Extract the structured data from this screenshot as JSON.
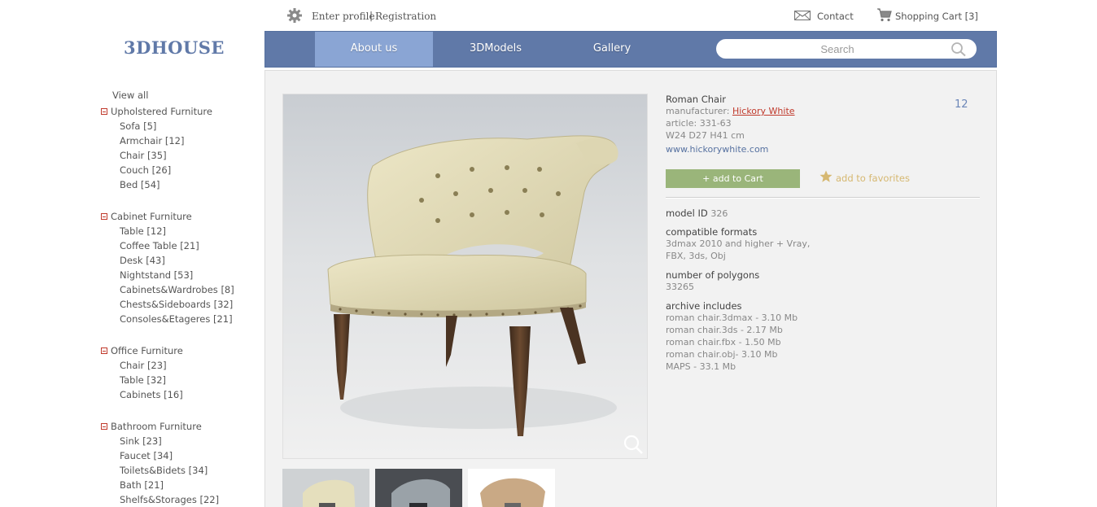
{
  "topbar": {
    "enter_profile": "Enter profile",
    "separator": "|",
    "registration": "Registration",
    "contact": "Contact",
    "cart": "Shopping Cart [3]"
  },
  "logo": "3DHOUSE",
  "nav": {
    "items": [
      {
        "label": "About us",
        "active": true
      },
      {
        "label": "3DModels",
        "active": false
      },
      {
        "label": "Gallery",
        "active": false
      }
    ],
    "search_placeholder": "Search"
  },
  "sidebar": {
    "view_all": "View all",
    "categories": [
      {
        "title": "Upholstered Furniture",
        "items": [
          "Sofa [5]",
          "Armchair [12]",
          "Chair [35]",
          "Couch [26]",
          "Bed [54]"
        ]
      },
      {
        "title": "Cabinet Furniture",
        "items": [
          "Table [12]",
          "Coffee Table [21]",
          "Desk [43]",
          "Nightstand [53]",
          "Cabinets&Wardrobes [8]",
          "Chests&Sideboards [32]",
          "Consoles&Etageres [21]"
        ]
      },
      {
        "title": "Office Furniture",
        "items": [
          "Chair [23]",
          "Table [32]",
          "Cabinets [16]"
        ]
      },
      {
        "title": "Bathroom Furniture",
        "items": [
          "Sink [23]",
          "Faucet [34]",
          "Toilets&Bidets [34]",
          "Bath [21]",
          "Shelfs&Storages [22]"
        ]
      }
    ]
  },
  "product": {
    "name": "Roman Chair",
    "manufacturer_label": "manufacturer:",
    "manufacturer": "Hickory White",
    "article": "article: 331-63",
    "dimensions": "W24 D27 H41 cm",
    "website": "www.hickorywhite.com",
    "count": "12",
    "add_to_cart": "+ add to Cart",
    "add_to_favorites": "add to favorites",
    "model_id_label": "model ID",
    "model_id": "326",
    "formats_label": "compatible formats",
    "formats": [
      "3dmax 2010 and higher + Vray,",
      "FBX, 3ds, Obj"
    ],
    "polygons_label": "number of polygons",
    "polygons": "33265",
    "archive_label": "archive includes",
    "archive": [
      "roman chair.3dmax - 3.10 Mb",
      "roman chair.3ds - 2.17 Mb",
      "roman chair.fbx - 1.50 Mb",
      "roman chair.obj- 3.10 Mb",
      "MAPS - 33.1 Mb"
    ]
  },
  "colors": {
    "nav_bg": "#6079a8",
    "nav_active": "#8aa5d4",
    "cart_button": "#9ab57a",
    "link_red": "#c0392b",
    "favorite": "#d6b871"
  }
}
